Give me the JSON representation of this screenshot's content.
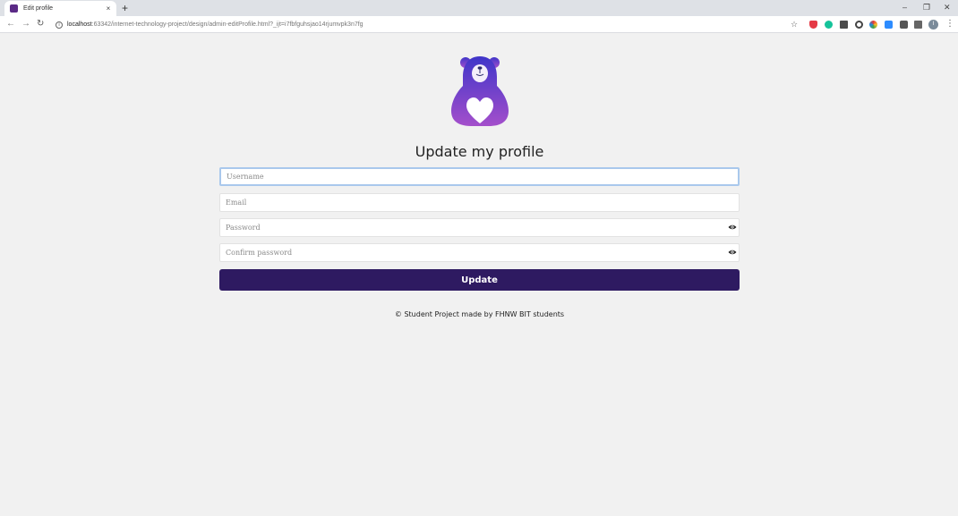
{
  "browser": {
    "tab_title": "Edit profile",
    "tab_close": "×",
    "new_tab": "+",
    "url_host": "localhost",
    "url_path": ":63342/internet-technology-project/design/admin-editProfile.html?_ijt=i7fbfguhsjao14rjumvpk3n7fg",
    "avatar_letter": "I",
    "minimize": "–",
    "restore": "❐",
    "close": "✕",
    "back": "←",
    "forward": "→",
    "reload": "↻",
    "star": "☆",
    "menu": "⋮"
  },
  "form": {
    "heading": "Update my profile",
    "username_placeholder": "Username",
    "email_placeholder": "Email",
    "password_placeholder": "Password",
    "confirm_placeholder": "Confirm password",
    "submit_label": "Update"
  },
  "footer": {
    "text": "© Student Project made by FHNW BIT students"
  },
  "colors": {
    "button": "#2e1a61",
    "logo_top": "#3f35c9",
    "logo_bottom": "#a44fcb",
    "focus_border": "#a9c8ec"
  },
  "icons": {
    "extensions": [
      "brave-shield-icon",
      "grammarly-icon",
      "ruler-icon",
      "circle-icon",
      "color-picker-icon",
      "screencast-icon",
      "puzzle-icon",
      "reading-list-icon"
    ]
  }
}
